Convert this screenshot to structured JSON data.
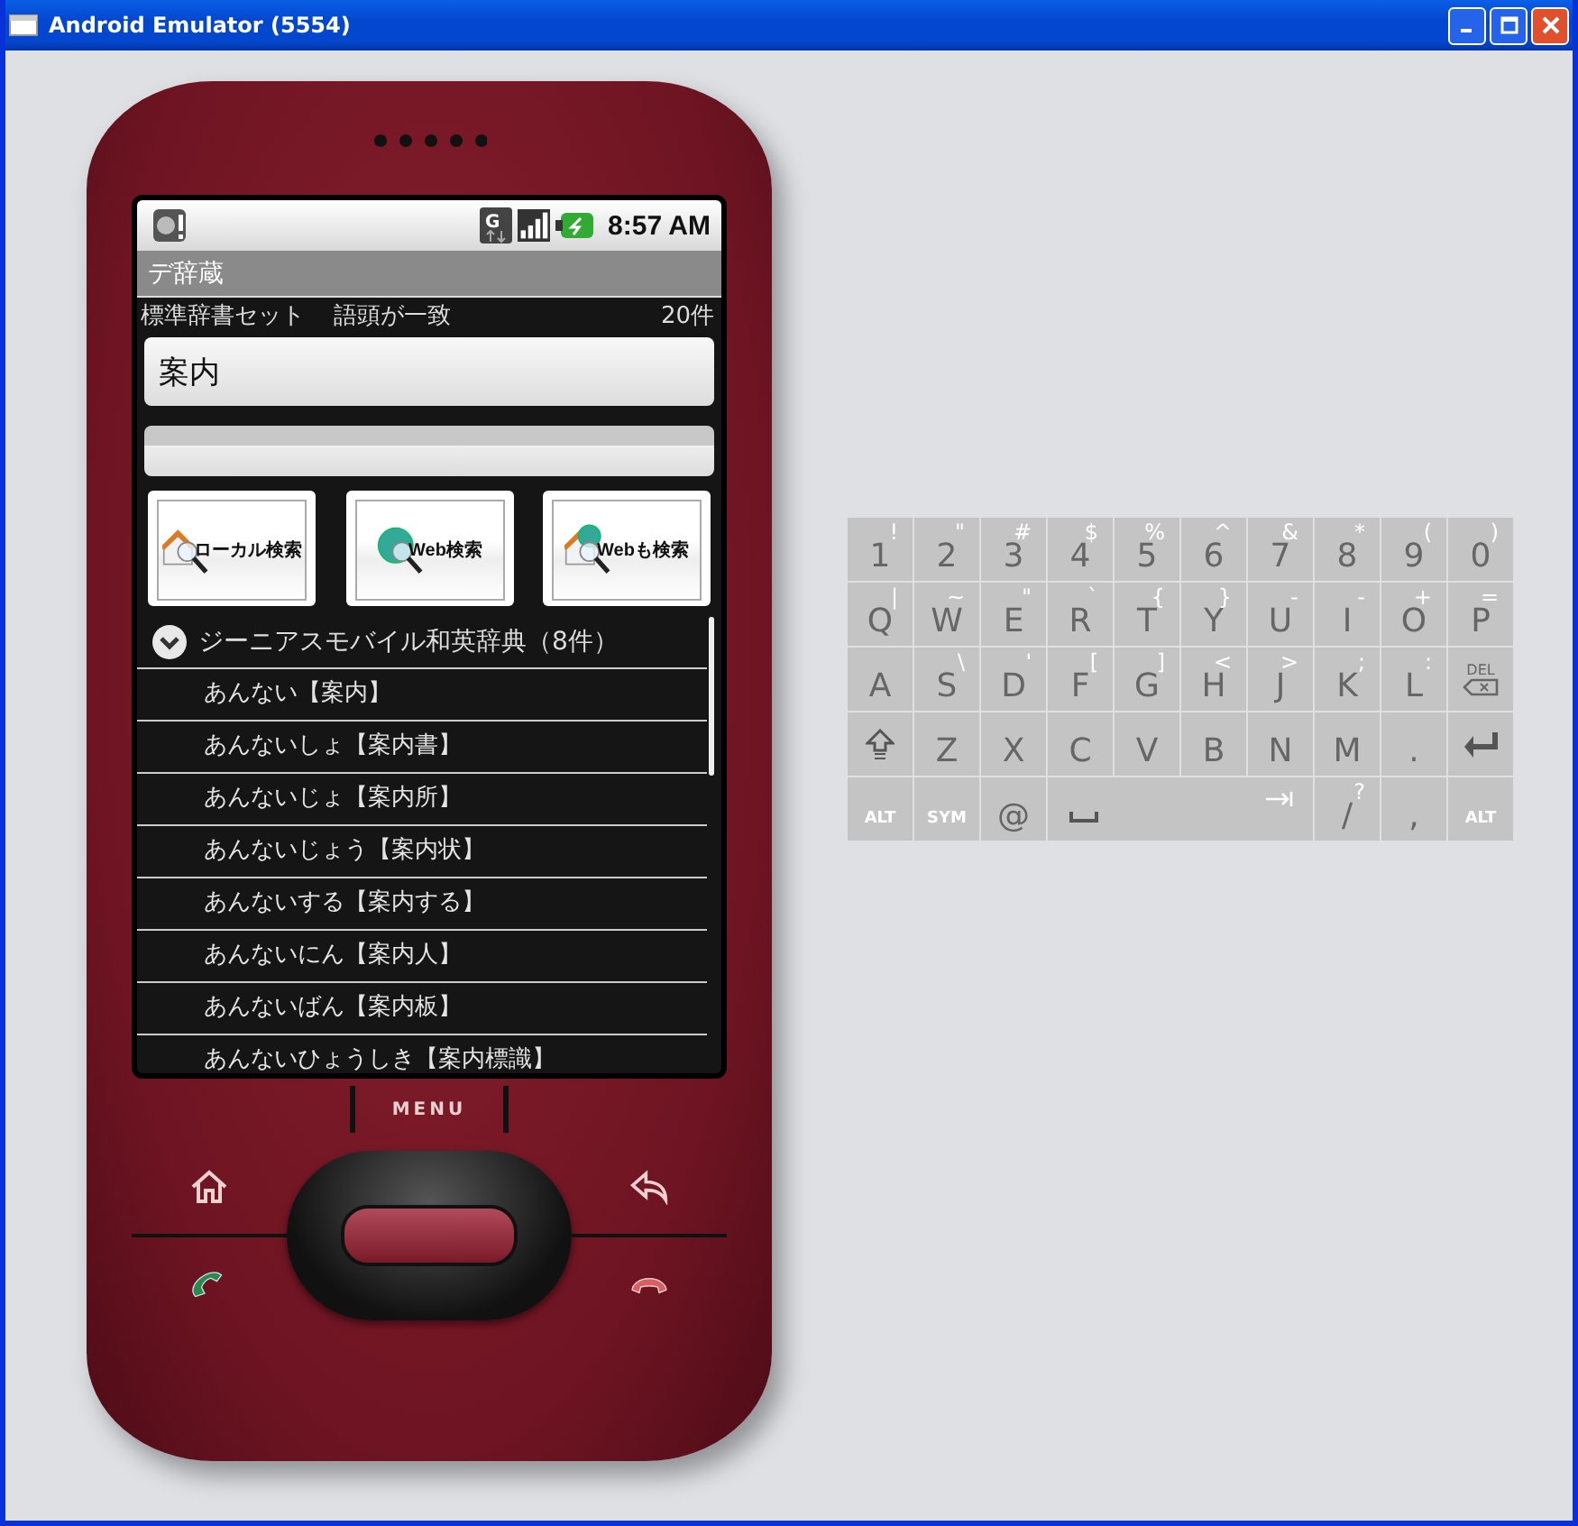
{
  "window": {
    "title": "Android Emulator (5554)"
  },
  "status_bar": {
    "network_type": "G",
    "time": "8:57 AM"
  },
  "app": {
    "title": "デ辞蔵",
    "dictionary_set": "標準辞書セット",
    "match_mode": "語頭が一致",
    "count": "20件"
  },
  "search": {
    "value": "案内"
  },
  "buttons": [
    {
      "kind": "local",
      "label": "ローカル検索"
    },
    {
      "kind": "web",
      "label": "Web検索"
    },
    {
      "kind": "both",
      "label": "Webも検索"
    }
  ],
  "results": {
    "group": {
      "title": "ジーニアスモバイル和英辞典（8件）",
      "expanded": true
    },
    "items": [
      "あんない【案内】",
      "あんないしょ【案内書】",
      "あんないじょ【案内所】",
      "あんないじょう【案内状】",
      "あんないする【案内する】",
      "あんないにん【案内人】",
      "あんないばん【案内板】",
      "あんないひょうしき【案内標識】"
    ]
  },
  "phone": {
    "menu_label": "MENU"
  },
  "keyboard": [
    [
      {
        "kind": "text",
        "main": "1",
        "alt": "!"
      },
      {
        "kind": "text",
        "main": "2",
        "alt": "\""
      },
      {
        "kind": "text",
        "main": "3",
        "alt": "#"
      },
      {
        "kind": "text",
        "main": "4",
        "alt": "$"
      },
      {
        "kind": "text",
        "main": "5",
        "alt": "%"
      },
      {
        "kind": "text",
        "main": "6",
        "alt": "^"
      },
      {
        "kind": "text",
        "main": "7",
        "alt": "&"
      },
      {
        "kind": "text",
        "main": "8",
        "alt": "*"
      },
      {
        "kind": "text",
        "main": "9",
        "alt": "("
      },
      {
        "kind": "text",
        "main": "0",
        "alt": ")"
      }
    ],
    [
      {
        "kind": "text",
        "main": "Q",
        "alt": "|"
      },
      {
        "kind": "text",
        "main": "W",
        "alt": "~"
      },
      {
        "kind": "text",
        "main": "E",
        "alt": "\""
      },
      {
        "kind": "text",
        "main": "R",
        "alt": "`"
      },
      {
        "kind": "text",
        "main": "T",
        "alt": "{"
      },
      {
        "kind": "text",
        "main": "Y",
        "alt": "}"
      },
      {
        "kind": "text",
        "main": "U",
        "alt": "-"
      },
      {
        "kind": "text",
        "main": "I",
        "alt": "-"
      },
      {
        "kind": "text",
        "main": "O",
        "alt": "+"
      },
      {
        "kind": "text",
        "main": "P",
        "alt": "="
      }
    ],
    [
      {
        "kind": "text",
        "main": "A"
      },
      {
        "kind": "text",
        "main": "S",
        "alt": "\\"
      },
      {
        "kind": "text",
        "main": "D",
        "alt": "'"
      },
      {
        "kind": "text",
        "main": "F",
        "alt": "["
      },
      {
        "kind": "text",
        "main": "G",
        "alt": "]"
      },
      {
        "kind": "text",
        "main": "H",
        "alt": "<"
      },
      {
        "kind": "text",
        "main": "J",
        "alt": ">"
      },
      {
        "kind": "text",
        "main": "K",
        "alt": ";"
      },
      {
        "kind": "text",
        "main": "L",
        "alt": ":"
      },
      {
        "kind": "del",
        "main": "DEL"
      }
    ],
    [
      {
        "kind": "shift"
      },
      {
        "kind": "text",
        "main": "Z"
      },
      {
        "kind": "text",
        "main": "X"
      },
      {
        "kind": "text",
        "main": "C"
      },
      {
        "kind": "text",
        "main": "V"
      },
      {
        "kind": "text",
        "main": "B"
      },
      {
        "kind": "text",
        "main": "N"
      },
      {
        "kind": "text",
        "main": "M"
      },
      {
        "kind": "text",
        "main": "."
      },
      {
        "kind": "enter"
      }
    ],
    [
      {
        "kind": "mod",
        "main": "ALT"
      },
      {
        "kind": "mod",
        "main": "SYM"
      },
      {
        "kind": "text",
        "main": "@"
      },
      {
        "kind": "space"
      },
      {
        "kind": "text",
        "main": "/",
        "alt": "?"
      },
      {
        "kind": "text",
        "main": ","
      },
      {
        "kind": "mod",
        "main": "ALT"
      }
    ]
  ]
}
